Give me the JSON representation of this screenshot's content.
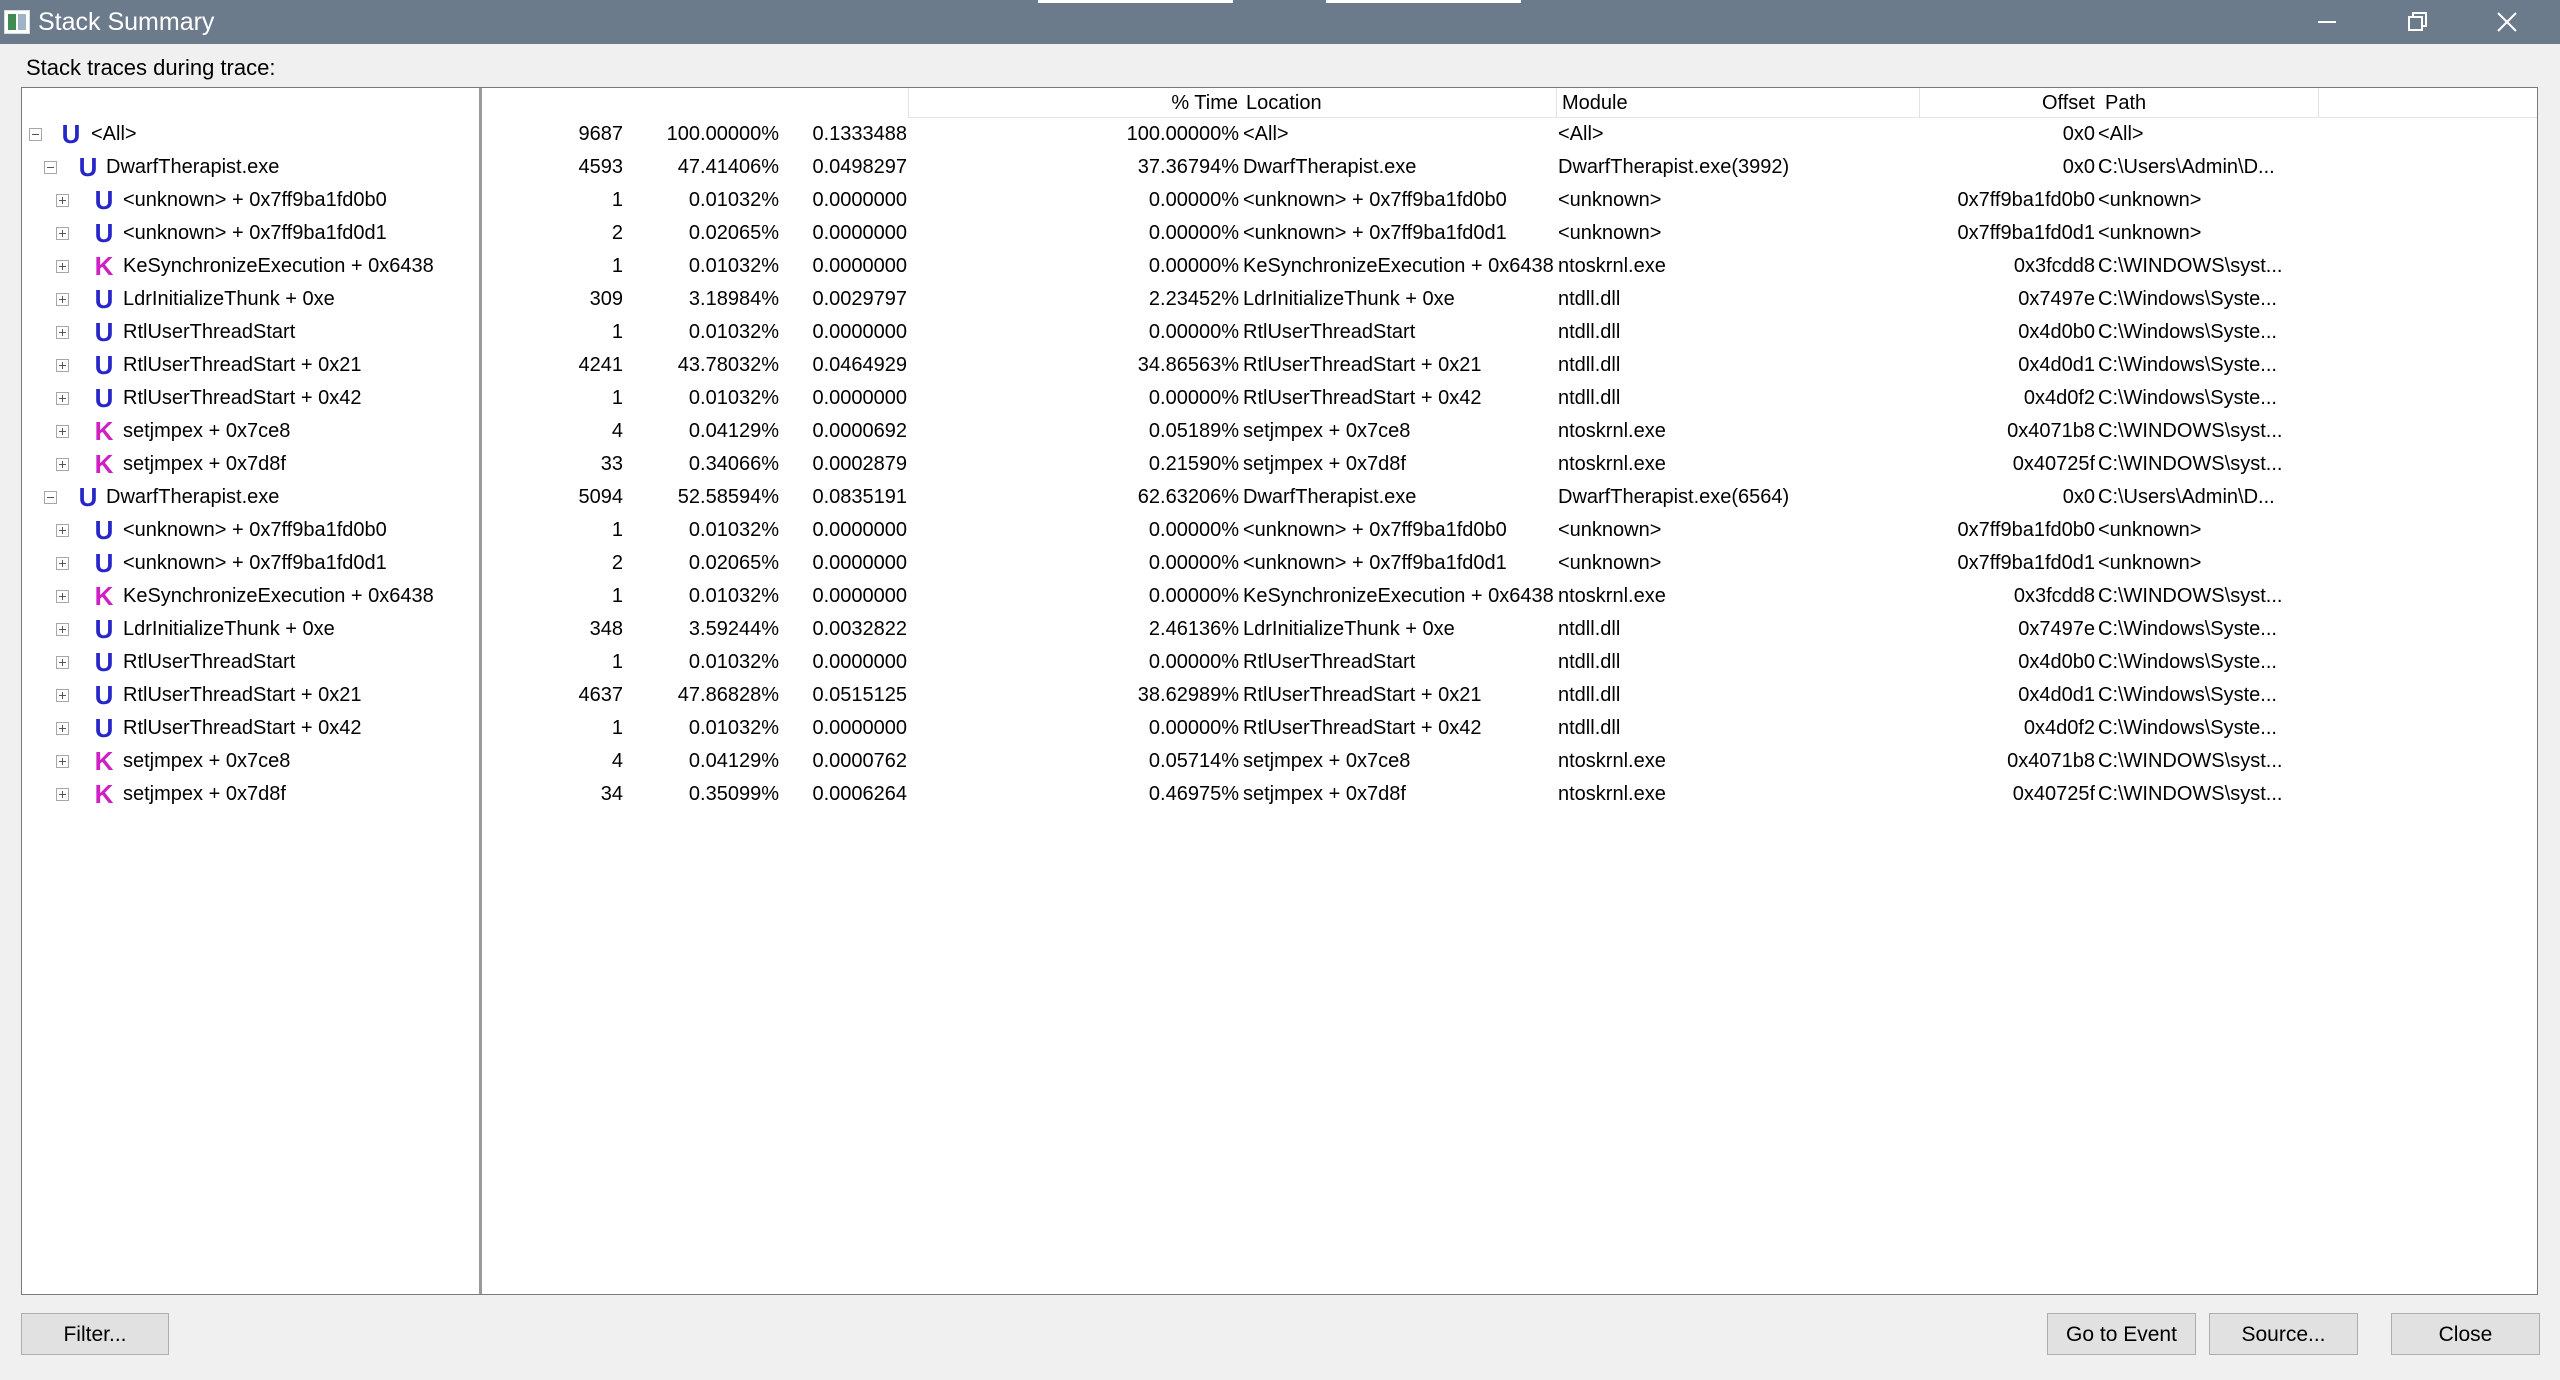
{
  "window": {
    "title": "Stack Summary"
  },
  "caption": "Stack traces during trace:",
  "columns": {
    "pct_time": "% Time",
    "location": "Location",
    "module": "Module",
    "offset": "Offset",
    "path": "Path"
  },
  "tree": [
    {
      "level": 0,
      "expander": "minus",
      "kind": "U",
      "name": "<All>"
    },
    {
      "level": 1,
      "expander": "minus",
      "kind": "U",
      "name": "DwarfTherapist.exe"
    },
    {
      "level": 2,
      "expander": "plus",
      "kind": "U",
      "name": "<unknown> + 0x7ff9ba1fd0b0"
    },
    {
      "level": 2,
      "expander": "plus",
      "kind": "U",
      "name": "<unknown> + 0x7ff9ba1fd0d1"
    },
    {
      "level": 2,
      "expander": "plus",
      "kind": "K",
      "name": "KeSynchronizeExecution + 0x6438"
    },
    {
      "level": 2,
      "expander": "plus",
      "kind": "U",
      "name": "LdrInitializeThunk + 0xe"
    },
    {
      "level": 2,
      "expander": "plus",
      "kind": "U",
      "name": "RtlUserThreadStart"
    },
    {
      "level": 2,
      "expander": "plus",
      "kind": "U",
      "name": "RtlUserThreadStart + 0x21"
    },
    {
      "level": 2,
      "expander": "plus",
      "kind": "U",
      "name": "RtlUserThreadStart + 0x42"
    },
    {
      "level": 2,
      "expander": "plus",
      "kind": "K",
      "name": "setjmpex + 0x7ce8"
    },
    {
      "level": 2,
      "expander": "plus",
      "kind": "K",
      "name": "setjmpex + 0x7d8f"
    },
    {
      "level": 1,
      "expander": "minus",
      "kind": "U",
      "name": "DwarfTherapist.exe"
    },
    {
      "level": 2,
      "expander": "plus",
      "kind": "U",
      "name": "<unknown> + 0x7ff9ba1fd0b0"
    },
    {
      "level": 2,
      "expander": "plus",
      "kind": "U",
      "name": "<unknown> + 0x7ff9ba1fd0d1"
    },
    {
      "level": 2,
      "expander": "plus",
      "kind": "K",
      "name": "KeSynchronizeExecution + 0x6438"
    },
    {
      "level": 2,
      "expander": "plus",
      "kind": "U",
      "name": "LdrInitializeThunk + 0xe"
    },
    {
      "level": 2,
      "expander": "plus",
      "kind": "U",
      "name": "RtlUserThreadStart"
    },
    {
      "level": 2,
      "expander": "plus",
      "kind": "U",
      "name": "RtlUserThreadStart + 0x21"
    },
    {
      "level": 2,
      "expander": "plus",
      "kind": "U",
      "name": "RtlUserThreadStart + 0x42"
    },
    {
      "level": 2,
      "expander": "plus",
      "kind": "K",
      "name": "setjmpex + 0x7ce8"
    },
    {
      "level": 2,
      "expander": "plus",
      "kind": "K",
      "name": "setjmpex + 0x7d8f"
    }
  ],
  "rows": [
    {
      "count": "9687",
      "pct": "100.00000%",
      "time": "0.1333488",
      "pct_time": "100.00000%",
      "location": "<All>",
      "module": "<All>",
      "offset": "0x0",
      "path": "<All>"
    },
    {
      "count": "4593",
      "pct": "47.41406%",
      "time": "0.0498297",
      "pct_time": "37.36794%",
      "location": "DwarfTherapist.exe",
      "module": "DwarfTherapist.exe(3992)",
      "offset": "0x0",
      "path": "C:\\Users\\Admin\\D..."
    },
    {
      "count": "1",
      "pct": "0.01032%",
      "time": "0.0000000",
      "pct_time": "0.00000%",
      "location": "<unknown> + 0x7ff9ba1fd0b0",
      "module": "<unknown>",
      "offset": "0x7ff9ba1fd0b0",
      "path": "<unknown>"
    },
    {
      "count": "2",
      "pct": "0.02065%",
      "time": "0.0000000",
      "pct_time": "0.00000%",
      "location": "<unknown> + 0x7ff9ba1fd0d1",
      "module": "<unknown>",
      "offset": "0x7ff9ba1fd0d1",
      "path": "<unknown>"
    },
    {
      "count": "1",
      "pct": "0.01032%",
      "time": "0.0000000",
      "pct_time": "0.00000%",
      "location": "KeSynchronizeExecution + 0x6438",
      "module": "ntoskrnl.exe",
      "offset": "0x3fcdd8",
      "path": "C:\\WINDOWS\\syst..."
    },
    {
      "count": "309",
      "pct": "3.18984%",
      "time": "0.0029797",
      "pct_time": "2.23452%",
      "location": "LdrInitializeThunk + 0xe",
      "module": "ntdll.dll",
      "offset": "0x7497e",
      "path": "C:\\Windows\\Syste..."
    },
    {
      "count": "1",
      "pct": "0.01032%",
      "time": "0.0000000",
      "pct_time": "0.00000%",
      "location": "RtlUserThreadStart",
      "module": "ntdll.dll",
      "offset": "0x4d0b0",
      "path": "C:\\Windows\\Syste..."
    },
    {
      "count": "4241",
      "pct": "43.78032%",
      "time": "0.0464929",
      "pct_time": "34.86563%",
      "location": "RtlUserThreadStart + 0x21",
      "module": "ntdll.dll",
      "offset": "0x4d0d1",
      "path": "C:\\Windows\\Syste..."
    },
    {
      "count": "1",
      "pct": "0.01032%",
      "time": "0.0000000",
      "pct_time": "0.00000%",
      "location": "RtlUserThreadStart + 0x42",
      "module": "ntdll.dll",
      "offset": "0x4d0f2",
      "path": "C:\\Windows\\Syste..."
    },
    {
      "count": "4",
      "pct": "0.04129%",
      "time": "0.0000692",
      "pct_time": "0.05189%",
      "location": "setjmpex + 0x7ce8",
      "module": "ntoskrnl.exe",
      "offset": "0x4071b8",
      "path": "C:\\WINDOWS\\syst..."
    },
    {
      "count": "33",
      "pct": "0.34066%",
      "time": "0.0002879",
      "pct_time": "0.21590%",
      "location": "setjmpex + 0x7d8f",
      "module": "ntoskrnl.exe",
      "offset": "0x40725f",
      "path": "C:\\WINDOWS\\syst..."
    },
    {
      "count": "5094",
      "pct": "52.58594%",
      "time": "0.0835191",
      "pct_time": "62.63206%",
      "location": "DwarfTherapist.exe",
      "module": "DwarfTherapist.exe(6564)",
      "offset": "0x0",
      "path": "C:\\Users\\Admin\\D..."
    },
    {
      "count": "1",
      "pct": "0.01032%",
      "time": "0.0000000",
      "pct_time": "0.00000%",
      "location": "<unknown> + 0x7ff9ba1fd0b0",
      "module": "<unknown>",
      "offset": "0x7ff9ba1fd0b0",
      "path": "<unknown>"
    },
    {
      "count": "2",
      "pct": "0.02065%",
      "time": "0.0000000",
      "pct_time": "0.00000%",
      "location": "<unknown> + 0x7ff9ba1fd0d1",
      "module": "<unknown>",
      "offset": "0x7ff9ba1fd0d1",
      "path": "<unknown>"
    },
    {
      "count": "1",
      "pct": "0.01032%",
      "time": "0.0000000",
      "pct_time": "0.00000%",
      "location": "KeSynchronizeExecution + 0x6438",
      "module": "ntoskrnl.exe",
      "offset": "0x3fcdd8",
      "path": "C:\\WINDOWS\\syst..."
    },
    {
      "count": "348",
      "pct": "3.59244%",
      "time": "0.0032822",
      "pct_time": "2.46136%",
      "location": "LdrInitializeThunk + 0xe",
      "module": "ntdll.dll",
      "offset": "0x7497e",
      "path": "C:\\Windows\\Syste..."
    },
    {
      "count": "1",
      "pct": "0.01032%",
      "time": "0.0000000",
      "pct_time": "0.00000%",
      "location": "RtlUserThreadStart",
      "module": "ntdll.dll",
      "offset": "0x4d0b0",
      "path": "C:\\Windows\\Syste..."
    },
    {
      "count": "4637",
      "pct": "47.86828%",
      "time": "0.0515125",
      "pct_time": "38.62989%",
      "location": "RtlUserThreadStart + 0x21",
      "module": "ntdll.dll",
      "offset": "0x4d0d1",
      "path": "C:\\Windows\\Syste..."
    },
    {
      "count": "1",
      "pct": "0.01032%",
      "time": "0.0000000",
      "pct_time": "0.00000%",
      "location": "RtlUserThreadStart + 0x42",
      "module": "ntdll.dll",
      "offset": "0x4d0f2",
      "path": "C:\\Windows\\Syste..."
    },
    {
      "count": "4",
      "pct": "0.04129%",
      "time": "0.0000762",
      "pct_time": "0.05714%",
      "location": "setjmpex + 0x7ce8",
      "module": "ntoskrnl.exe",
      "offset": "0x4071b8",
      "path": "C:\\WINDOWS\\syst..."
    },
    {
      "count": "34",
      "pct": "0.35099%",
      "time": "0.0006264",
      "pct_time": "0.46975%",
      "location": "setjmpex + 0x7d8f",
      "module": "ntoskrnl.exe",
      "offset": "0x40725f",
      "path": "C:\\WINDOWS\\syst..."
    }
  ],
  "buttons": {
    "filter": "Filter...",
    "go_to_event": "Go to Event",
    "source": "Source...",
    "close": "Close"
  },
  "icons": {
    "user_mode": "U",
    "kernel_mode": "K",
    "minimize": "minimize-icon",
    "restore": "restore-icon",
    "close": "close-icon"
  },
  "colors": {
    "titlebar": "#6b7b8c",
    "user_icon": "#2727c9",
    "kernel_icon": "#d01fc4"
  }
}
